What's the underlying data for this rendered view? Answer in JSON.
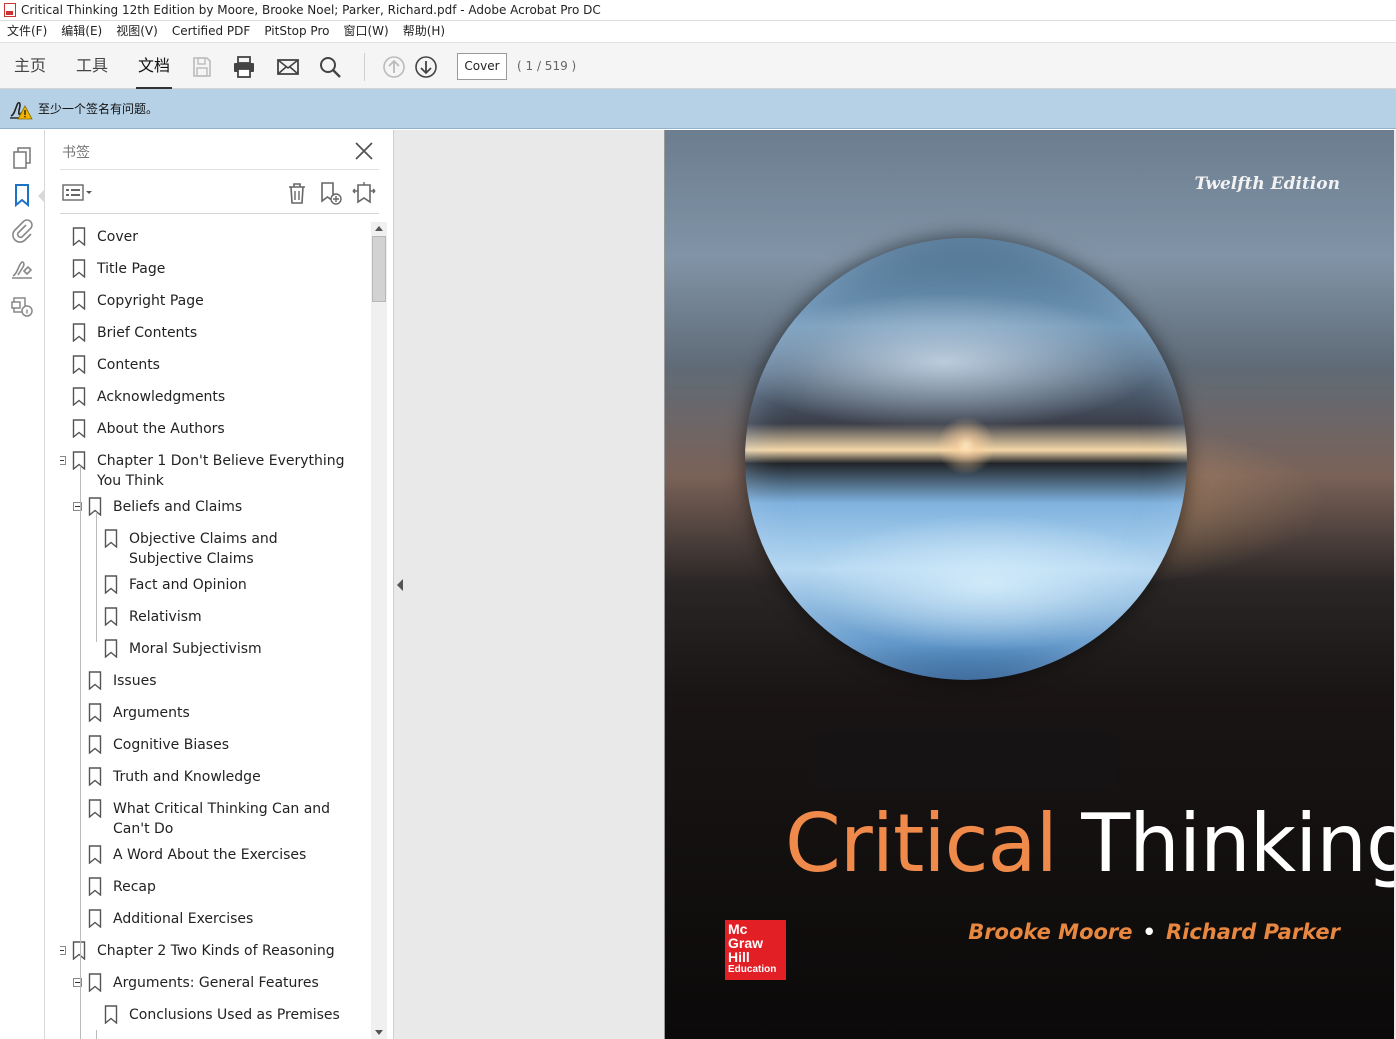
{
  "window": {
    "title": "Critical Thinking 12th Edition by Moore, Brooke Noel; Parker, Richard.pdf - Adobe Acrobat Pro DC"
  },
  "menubar": {
    "items": [
      "文件(F)",
      "编辑(E)",
      "视图(V)",
      "Certified PDF",
      "PitStop Pro",
      "窗口(W)",
      "帮助(H)"
    ]
  },
  "toolbar": {
    "tabs": [
      "主页",
      "工具",
      "文档"
    ],
    "active_tab": "文档",
    "current_page_label": "Cover",
    "page_count_text": "( 1 / 519 )",
    "icons": [
      "save-icon",
      "print-icon",
      "email-icon",
      "search-icon",
      "previous-page-icon",
      "next-page-icon"
    ]
  },
  "signature_bar": {
    "message": "至少一个签名有问题。"
  },
  "left_rail": {
    "icons": [
      "page-thumbnails-icon",
      "bookmarks-icon",
      "attachments-icon",
      "signatures-icon",
      "content-protection-icon"
    ]
  },
  "bookmarks": {
    "title": "书签",
    "items": [
      {
        "label": "Cover",
        "level": 0,
        "expanded": false
      },
      {
        "label": "Title Page",
        "level": 0,
        "expanded": false
      },
      {
        "label": "Copyright Page",
        "level": 0,
        "expanded": false
      },
      {
        "label": "Brief Contents",
        "level": 0,
        "expanded": false
      },
      {
        "label": "Contents",
        "level": 0,
        "expanded": false
      },
      {
        "label": "Acknowledgments",
        "level": 0,
        "expanded": false
      },
      {
        "label": "About the Authors",
        "level": 0,
        "expanded": false
      },
      {
        "label": "Chapter 1 Don't Believe Everything You Think",
        "level": 0,
        "expanded": true
      },
      {
        "label": "Beliefs and Claims",
        "level": 1,
        "expanded": true
      },
      {
        "label": "Objective Claims and Subjective Claims",
        "level": 2,
        "expanded": false
      },
      {
        "label": "Fact and Opinion",
        "level": 2,
        "expanded": false
      },
      {
        "label": "Relativism",
        "level": 2,
        "expanded": false
      },
      {
        "label": "Moral Subjectivism",
        "level": 2,
        "expanded": false
      },
      {
        "label": "Issues",
        "level": 1,
        "expanded": false
      },
      {
        "label": "Arguments",
        "level": 1,
        "expanded": false
      },
      {
        "label": "Cognitive Biases",
        "level": 1,
        "expanded": false
      },
      {
        "label": "Truth and Knowledge",
        "level": 1,
        "expanded": false
      },
      {
        "label": "What Critical Thinking Can and Can't Do",
        "level": 1,
        "expanded": false
      },
      {
        "label": "A Word About the Exercises",
        "level": 1,
        "expanded": false
      },
      {
        "label": "Recap",
        "level": 1,
        "expanded": false
      },
      {
        "label": "Additional Exercises",
        "level": 1,
        "expanded": false
      },
      {
        "label": "Chapter 2 Two Kinds of Reasoning",
        "level": 0,
        "expanded": true
      },
      {
        "label": "Arguments: General Features",
        "level": 1,
        "expanded": true
      },
      {
        "label": "Conclusions Used as Premises",
        "level": 2,
        "expanded": false
      }
    ]
  },
  "cover": {
    "edition": "Twelfth Edition",
    "title_part1": "Critical",
    "title_part2": "Thinking",
    "author1": "Brooke Moore",
    "separator": "•",
    "author2": "Richard Parker",
    "publisher_line1": "Mc",
    "publisher_line2": "Graw",
    "publisher_line3": "Hill",
    "publisher_line4": "Education"
  },
  "colors": {
    "signature_bar_bg": "#b6d0e5",
    "title_orange": "#f08a4b",
    "logo_red": "#e31f26"
  }
}
